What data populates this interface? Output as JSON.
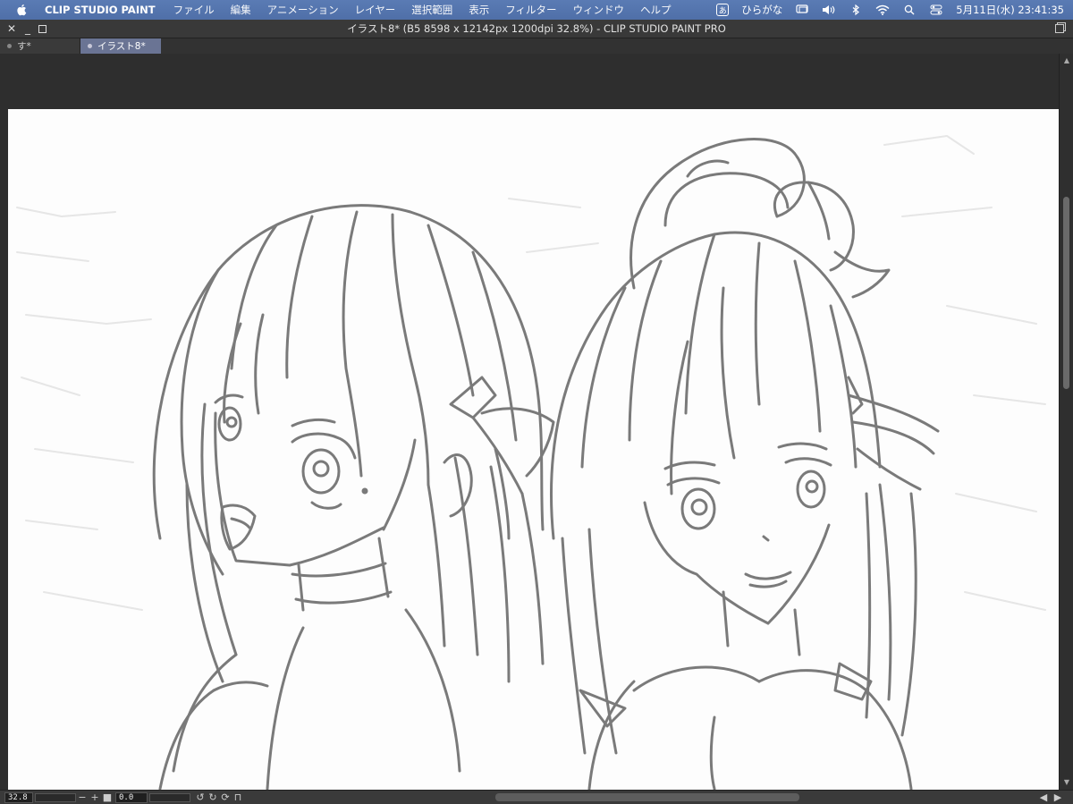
{
  "menubar": {
    "app_name": "CLIP STUDIO PAINT",
    "items": [
      "ファイル",
      "編集",
      "アニメーション",
      "レイヤー",
      "選択範囲",
      "表示",
      "フィルター",
      "ウィンドウ",
      "ヘルプ"
    ],
    "ime_label": "ひらがな",
    "datetime": "5月11日(水)  23:41:35"
  },
  "window": {
    "title": "イラスト8* (B5 8598 x 12142px 1200dpi 32.8%)  - CLIP STUDIO PAINT PRO"
  },
  "tabs": [
    {
      "label": "す*"
    },
    {
      "label": "イラスト8*"
    }
  ],
  "status": {
    "zoom": "32.8",
    "rotation": "0.0"
  },
  "colors": {
    "menubar": "#5a7bb4",
    "active_tab": "#6a7494",
    "line_art": "#7a7a7a"
  }
}
